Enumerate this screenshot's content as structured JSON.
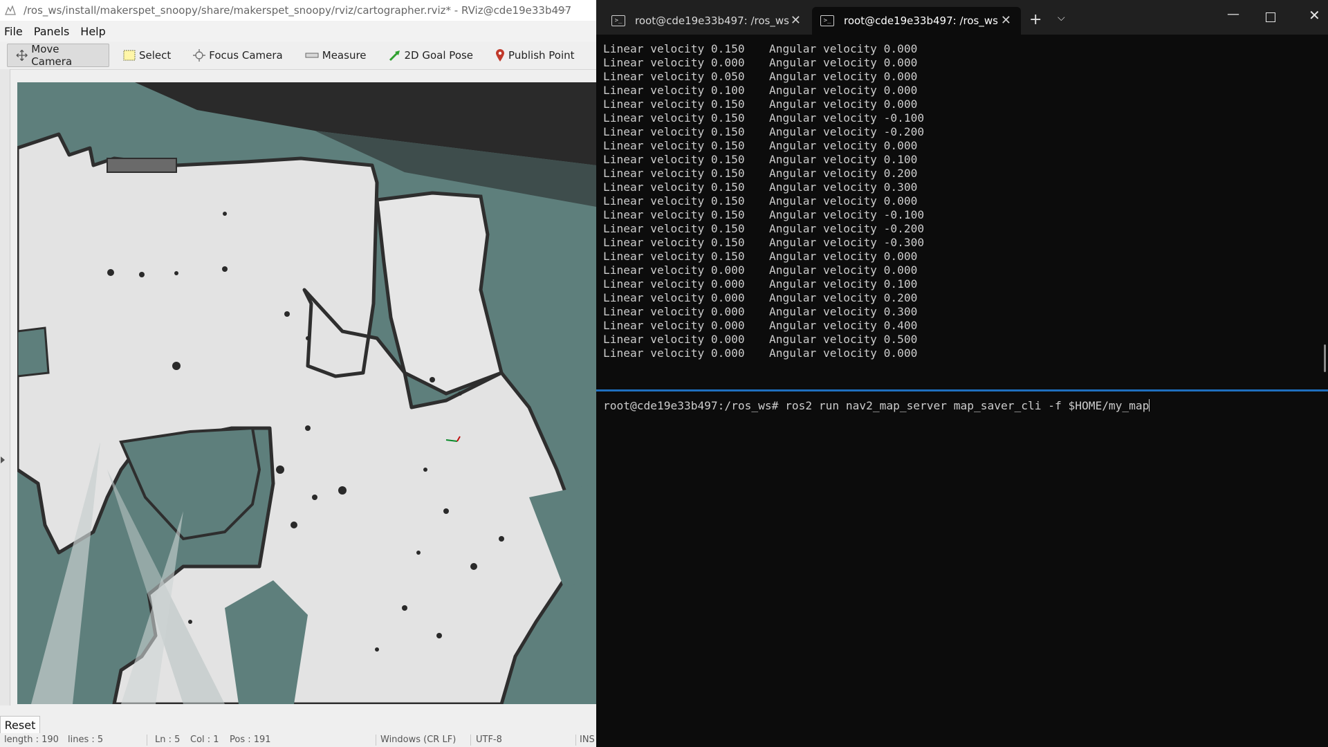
{
  "rviz": {
    "title": "/ros_ws/install/makerspet_snoopy/share/makerspet_snoopy/rviz/cartographer.rviz* - RViz@cde19e33b497",
    "menu": [
      "File",
      "Panels",
      "Help"
    ],
    "tools": [
      {
        "label": "Move Camera",
        "icon": "move-camera-icon",
        "active": true
      },
      {
        "label": "Select",
        "icon": "select-icon"
      },
      {
        "label": "Focus Camera",
        "icon": "focus-camera-icon"
      },
      {
        "label": "Measure",
        "icon": "ruler-icon"
      },
      {
        "label": "2D Goal Pose",
        "icon": "arrow-icon",
        "color": "#2fa02f"
      },
      {
        "label": "Publish Point",
        "icon": "map-pin-icon",
        "color": "#c0392b"
      }
    ],
    "reset_label": "Reset",
    "statusbar": {
      "length": "length : 190",
      "lines": "lines : 5",
      "ln": "Ln : 5",
      "col": "Col : 1",
      "pos": "Pos : 191",
      "eol": "Windows (CR LF)",
      "encoding": "UTF-8",
      "mode": "INS"
    },
    "map_colors": {
      "unknown": "#5e7f7c",
      "free": "#e4e4e4",
      "occupied": "#2b2b2b"
    }
  },
  "terminal": {
    "tabs": [
      {
        "label": "root@cde19e33b497: /ros_ws",
        "active": false
      },
      {
        "label": "root@cde19e33b497: /ros_ws",
        "active": true
      }
    ],
    "log": [
      {
        "linear": "Linear velocity 0.150",
        "angular": "Angular velocity 0.000"
      },
      {
        "linear": "Linear velocity 0.000",
        "angular": "Angular velocity 0.000"
      },
      {
        "linear": "Linear velocity 0.050",
        "angular": "Angular velocity 0.000"
      },
      {
        "linear": "Linear velocity 0.100",
        "angular": "Angular velocity 0.000"
      },
      {
        "linear": "Linear velocity 0.150",
        "angular": "Angular velocity 0.000"
      },
      {
        "linear": "Linear velocity 0.150",
        "angular": "Angular velocity -0.100"
      },
      {
        "linear": "Linear velocity 0.150",
        "angular": "Angular velocity -0.200"
      },
      {
        "linear": "Linear velocity 0.150",
        "angular": "Angular velocity 0.000"
      },
      {
        "linear": "Linear velocity 0.150",
        "angular": "Angular velocity 0.100"
      },
      {
        "linear": "Linear velocity 0.150",
        "angular": "Angular velocity 0.200"
      },
      {
        "linear": "Linear velocity 0.150",
        "angular": "Angular velocity 0.300"
      },
      {
        "linear": "Linear velocity 0.150",
        "angular": "Angular velocity 0.000"
      },
      {
        "linear": "Linear velocity 0.150",
        "angular": "Angular velocity -0.100"
      },
      {
        "linear": "Linear velocity 0.150",
        "angular": "Angular velocity -0.200"
      },
      {
        "linear": "Linear velocity 0.150",
        "angular": "Angular velocity -0.300"
      },
      {
        "linear": "Linear velocity 0.150",
        "angular": "Angular velocity 0.000"
      },
      {
        "linear": "Linear velocity 0.000",
        "angular": "Angular velocity 0.000"
      },
      {
        "linear": "Linear velocity 0.000",
        "angular": "Angular velocity 0.100"
      },
      {
        "linear": "Linear velocity 0.000",
        "angular": "Angular velocity 0.200"
      },
      {
        "linear": "Linear velocity 0.000",
        "angular": "Angular velocity 0.300"
      },
      {
        "linear": "Linear velocity 0.000",
        "angular": "Angular velocity 0.400"
      },
      {
        "linear": "Linear velocity 0.000",
        "angular": "Angular velocity 0.500"
      },
      {
        "linear": "Linear velocity 0.000",
        "angular": "Angular velocity 0.000"
      }
    ],
    "prompt": "root@cde19e33b497:/ros_ws# ",
    "command": "ros2 run nav2_map_server map_saver_cli -f $HOME/my_map",
    "accent": "#1f6fbf"
  }
}
